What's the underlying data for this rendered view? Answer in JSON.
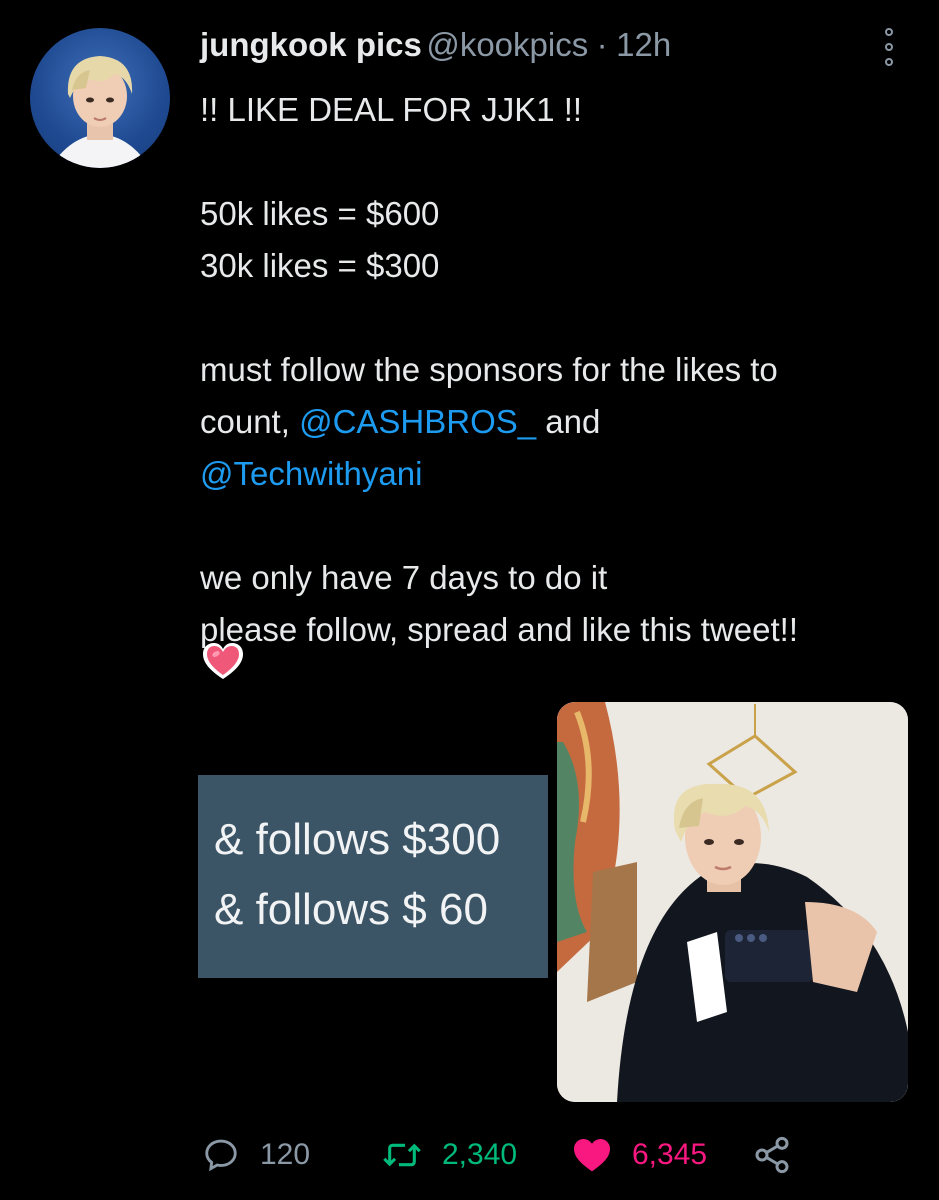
{
  "tweet": {
    "author_name": "jungkook pics",
    "author_handle": "@kookpics",
    "separator": "·",
    "time": "12h",
    "lines": {
      "l1": "!! LIKE DEAL FOR JJK1 !!",
      "l2": "50k likes = $600",
      "l3": "30k likes = $300",
      "l4": "must follow the sponsors for the likes to",
      "l5_prefix": "count, ",
      "mention1": "@CASHBROS_",
      "l5_suffix": " and",
      "mention2": "@Techwithyani",
      "l6": "we only have 7 days to do it",
      "l7": "please follow, spread and like this tweet!!"
    },
    "emoji": "heart-emoji",
    "media": {
      "left_image_text": [
        "& follows $300",
        "& follows $ 60"
      ],
      "right_image": "photo-selfie"
    },
    "actions": {
      "replies": "120",
      "retweets": "2,340",
      "likes": "6,345"
    },
    "icons": [
      "reply-icon",
      "retweet-icon",
      "like-icon",
      "share-icon",
      "more-icon"
    ],
    "colors": {
      "background": "#000000",
      "text": "#e7e9ea",
      "muted": "#8b98a5",
      "link": "#1d9bf0",
      "retweet": "#00ba7c",
      "like": "#f91880"
    }
  }
}
